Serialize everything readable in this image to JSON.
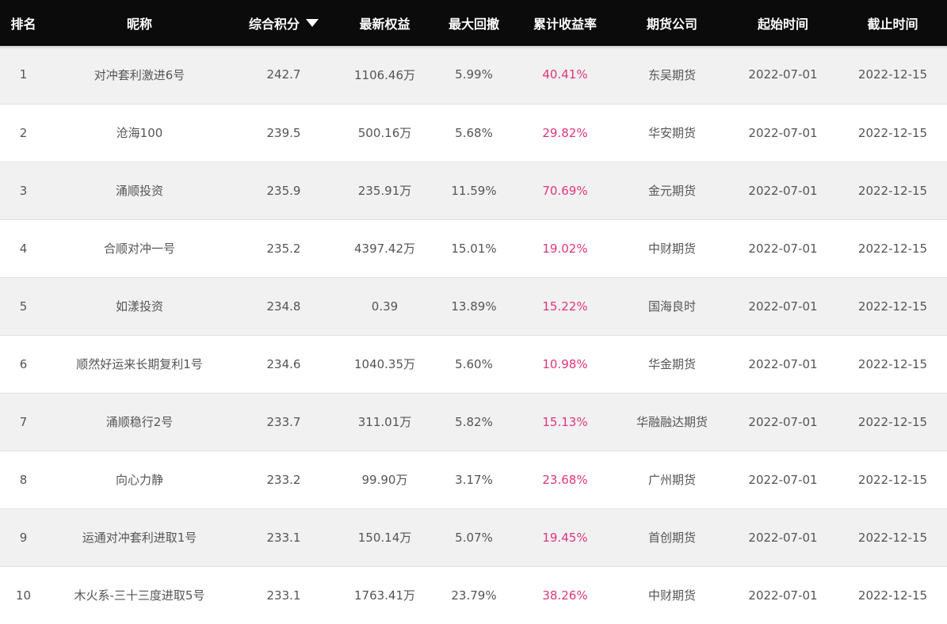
{
  "headers": {
    "rank": "排名",
    "name": "昵称",
    "score": "综合积分",
    "equity": "最新权益",
    "drawdown": "最大回撤",
    "return": "累计收益率",
    "broker": "期货公司",
    "start": "起始时间",
    "end": "截止时间"
  },
  "sort": {
    "column": "score",
    "direction": "descending"
  },
  "colors": {
    "header_bg": "#0b0b0b",
    "return_text": "#e0367a",
    "zebra_row": "#f1f1f1"
  },
  "rows": [
    {
      "rank": "1",
      "name": "对冲套利激进6号",
      "score": "242.7",
      "equity": "1106.46万",
      "drawdown": "5.99%",
      "return": "40.41%",
      "broker": "东吴期货",
      "start": "2022-07-01",
      "end": "2022-12-15"
    },
    {
      "rank": "2",
      "name": "沧海100",
      "score": "239.5",
      "equity": "500.16万",
      "drawdown": "5.68%",
      "return": "29.82%",
      "broker": "华安期货",
      "start": "2022-07-01",
      "end": "2022-12-15"
    },
    {
      "rank": "3",
      "name": "涌顺投资",
      "score": "235.9",
      "equity": "235.91万",
      "drawdown": "11.59%",
      "return": "70.69%",
      "broker": "金元期货",
      "start": "2022-07-01",
      "end": "2022-12-15"
    },
    {
      "rank": "4",
      "name": "合顺对冲一号",
      "score": "235.2",
      "equity": "4397.42万",
      "drawdown": "15.01%",
      "return": "19.02%",
      "broker": "中财期货",
      "start": "2022-07-01",
      "end": "2022-12-15"
    },
    {
      "rank": "5",
      "name": "如漾投资",
      "score": "234.8",
      "equity": "0.39",
      "drawdown": "13.89%",
      "return": "15.22%",
      "broker": "国海良时",
      "start": "2022-07-01",
      "end": "2022-12-15"
    },
    {
      "rank": "6",
      "name": "顺然好运来长期复利1号",
      "score": "234.6",
      "equity": "1040.35万",
      "drawdown": "5.60%",
      "return": "10.98%",
      "broker": "华金期货",
      "start": "2022-07-01",
      "end": "2022-12-15"
    },
    {
      "rank": "7",
      "name": "涌顺稳行2号",
      "score": "233.7",
      "equity": "311.01万",
      "drawdown": "5.82%",
      "return": "15.13%",
      "broker": "华融融达期货",
      "start": "2022-07-01",
      "end": "2022-12-15"
    },
    {
      "rank": "8",
      "name": "向心力静",
      "score": "233.2",
      "equity": "99.90万",
      "drawdown": "3.17%",
      "return": "23.68%",
      "broker": "广州期货",
      "start": "2022-07-01",
      "end": "2022-12-15"
    },
    {
      "rank": "9",
      "name": "运通对冲套利进取1号",
      "score": "233.1",
      "equity": "150.14万",
      "drawdown": "5.07%",
      "return": "19.45%",
      "broker": "首创期货",
      "start": "2022-07-01",
      "end": "2022-12-15"
    },
    {
      "rank": "10",
      "name": "木火系-三十三度进取5号",
      "score": "233.1",
      "equity": "1763.41万",
      "drawdown": "23.79%",
      "return": "38.26%",
      "broker": "中财期货",
      "start": "2022-07-01",
      "end": "2022-12-15"
    }
  ]
}
